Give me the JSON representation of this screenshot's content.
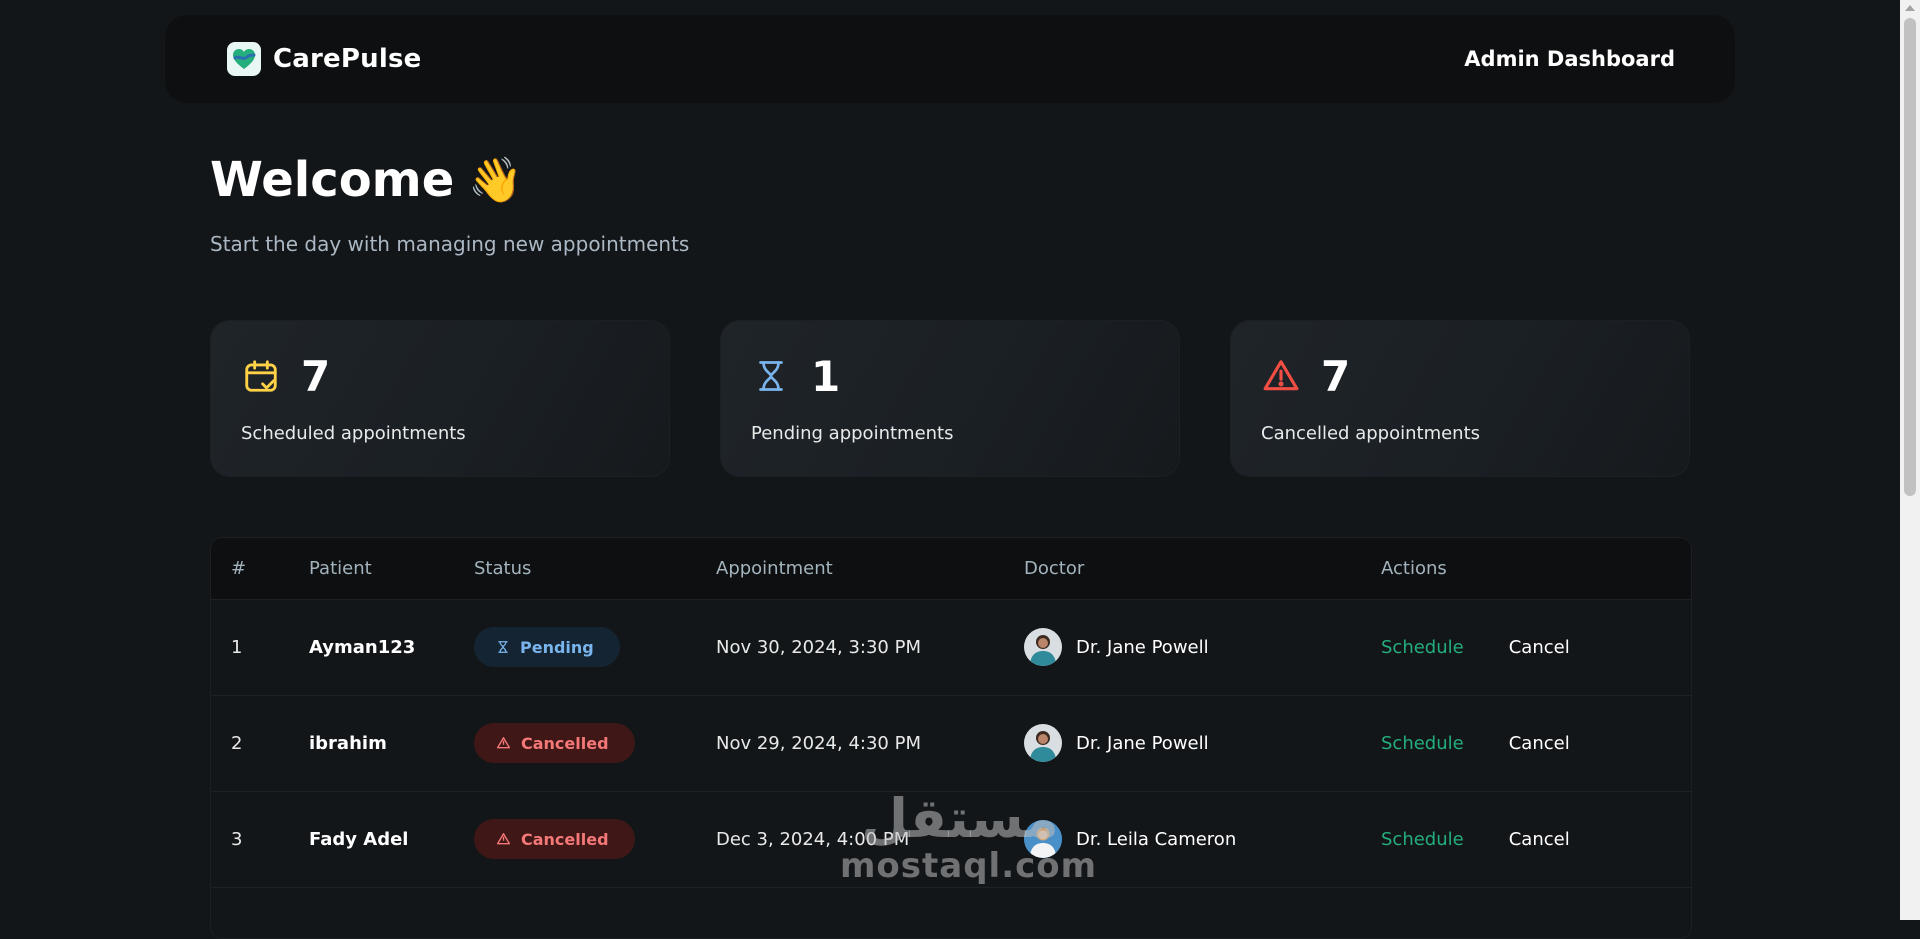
{
  "header": {
    "brand": "CarePulse",
    "title": "Admin Dashboard"
  },
  "welcome": {
    "title": "Welcome",
    "emoji": "👋",
    "subtitle": "Start the day with managing new appointments"
  },
  "stats": [
    {
      "count": "7",
      "label": "Scheduled appointments",
      "icon": "calendar-check-icon",
      "color": "#ffd147"
    },
    {
      "count": "1",
      "label": "Pending appointments",
      "icon": "hourglass-icon",
      "color": "#79b5ec"
    },
    {
      "count": "7",
      "label": "Cancelled appointments",
      "icon": "alert-triangle-icon",
      "color": "#f24e43"
    }
  ],
  "table": {
    "headers": [
      "#",
      "Patient",
      "Status",
      "Appointment",
      "Doctor",
      "Actions"
    ],
    "rows": [
      {
        "index": "1",
        "patient": "Ayman123",
        "status": "Pending",
        "appointment": "Nov 30, 2024, 3:30 PM",
        "doctor": "Dr. Jane Powell",
        "schedule": "Schedule",
        "cancel": "Cancel"
      },
      {
        "index": "2",
        "patient": "ibrahim",
        "status": "Cancelled",
        "appointment": "Nov 29, 2024, 4:30 PM",
        "doctor": "Dr. Jane Powell",
        "schedule": "Schedule",
        "cancel": "Cancel"
      },
      {
        "index": "3",
        "patient": "Fady Adel",
        "status": "Cancelled",
        "appointment": "Dec 3, 2024, 4:00 PM",
        "doctor": "Dr. Leila Cameron",
        "schedule": "Schedule",
        "cancel": "Cancel"
      }
    ]
  },
  "watermark": {
    "arabic": "مستقل",
    "latin": "mostaql.com"
  },
  "colors": {
    "background": "#131619",
    "schedule_green": "#24ae7c",
    "pending_blue": "#79b5ec",
    "cancelled_red": "#f37877"
  }
}
